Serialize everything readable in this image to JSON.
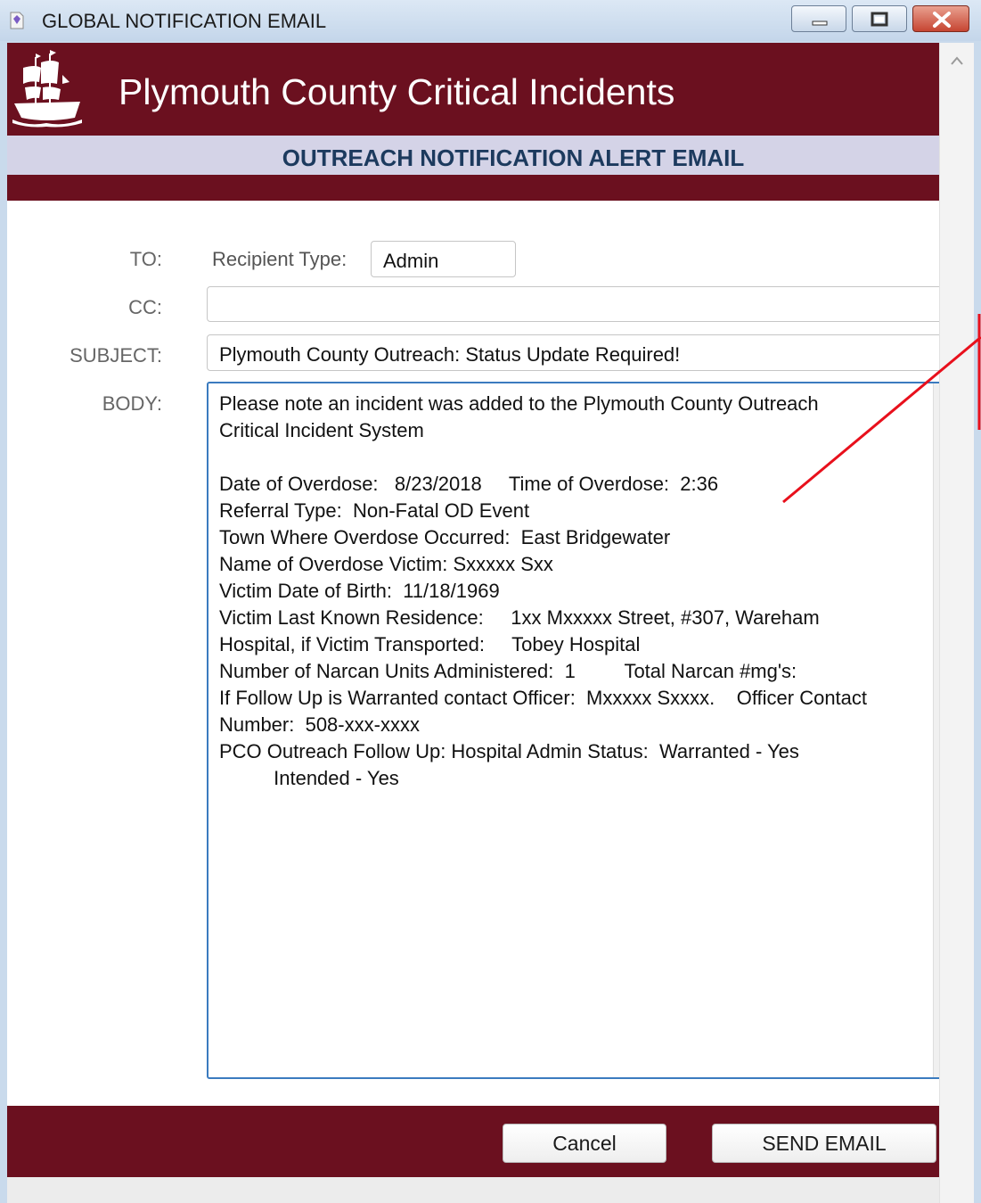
{
  "window": {
    "title": "GLOBAL NOTIFICATION EMAIL",
    "icons": {
      "app": "document-icon",
      "minimize": "minimize-icon",
      "maximize": "restore-icon",
      "close": "close-icon"
    }
  },
  "header": {
    "title": "Plymouth County Critical Incidents",
    "logo": "ship-icon",
    "subtitle": "OUTREACH NOTIFICATION ALERT EMAIL"
  },
  "form": {
    "to_label": "TO:",
    "recipient_type_label": "Recipient Type:",
    "recipient_type_value": "Admin",
    "cc_label": "CC:",
    "cc_value": "",
    "subject_label": "SUBJECT:",
    "subject_value": "Plymouth County Outreach: Status Update Required!",
    "body_label": "BODY:",
    "body_value": "Please note an incident was added to the Plymouth County Outreach\nCritical Incident System\n\nDate of Overdose:   8/23/2018     Time of Overdose:  2:36\nReferral Type:  Non-Fatal OD Event\nTown Where Overdose Occurred:  East Bridgewater\nName of Overdose Victim: Sxxxxx Sxx\nVictim Date of Birth:  11/18/1969\nVictim Last Known Residence:     1xx Mxxxxx Street, #307, Wareham\nHospital, if Victim Transported:     Tobey Hospital\nNumber of Narcan Units Administered:  1         Total Narcan #mg's:\nIf Follow Up is Warranted contact Officer:  Mxxxxx Sxxxx.    Officer Contact\nNumber:  508-xxx-xxxx\nPCO Outreach Follow Up: Hospital Admin Status:  Warranted - Yes\n          Intended - Yes"
  },
  "buttons": {
    "cancel": "Cancel",
    "send": "SEND EMAIL"
  },
  "colors": {
    "brand": "#6b101f",
    "subtitle_band": "#d4d3e7",
    "subtitle_text": "#1c3a5e",
    "annotation": "#e8101c"
  }
}
